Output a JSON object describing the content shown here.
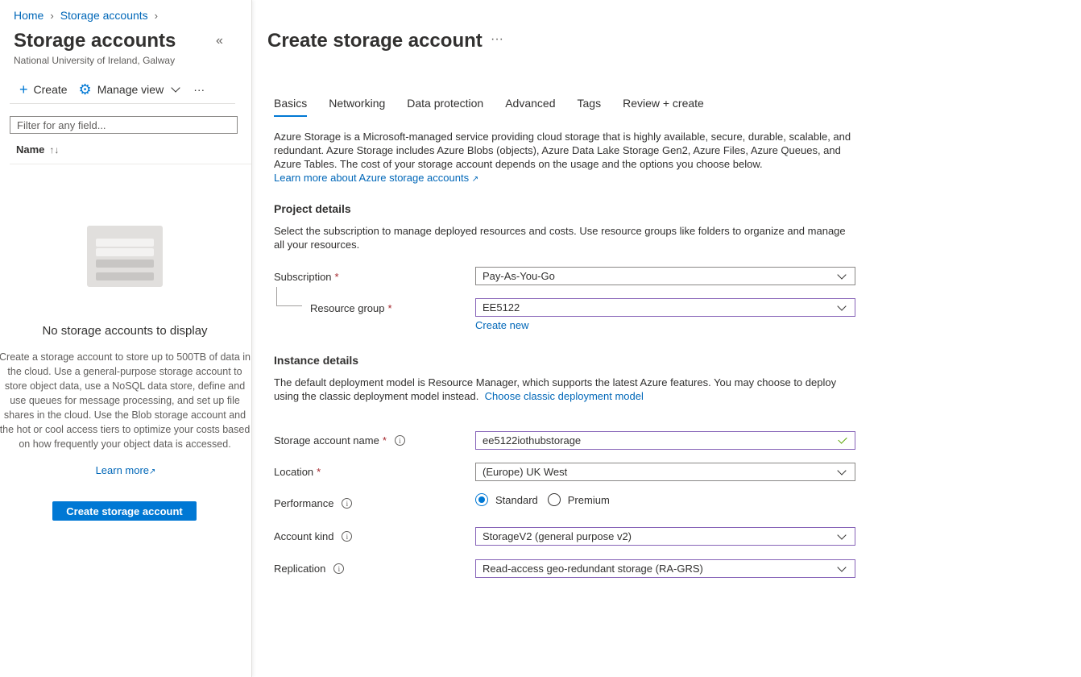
{
  "breadcrumb": {
    "home": "Home",
    "storage_accounts": "Storage accounts"
  },
  "left": {
    "title": "Storage accounts",
    "subtitle": "National University of Ireland, Galway",
    "toolbar": {
      "create": "Create",
      "manage_view": "Manage view",
      "more": "···"
    },
    "filter_placeholder": "Filter for any field...",
    "column_name": "Name",
    "empty_title": "No storage accounts to display",
    "empty_description": "Create a storage account to store up to 500TB of data in the cloud. Use a general-purpose storage account to store object data, use a NoSQL data store, define and use queues for message processing, and set up file shares in the cloud. Use the Blob storage account and the hot or cool access tiers to optimize your costs based on how frequently your object data is accessed.",
    "learn_more": "Learn more",
    "create_button": "Create storage account"
  },
  "main": {
    "title": "Create storage account",
    "more": "···",
    "tabs": [
      {
        "label": "Basics",
        "active": true
      },
      {
        "label": "Networking",
        "active": false
      },
      {
        "label": "Data protection",
        "active": false
      },
      {
        "label": "Advanced",
        "active": false
      },
      {
        "label": "Tags",
        "active": false
      },
      {
        "label": "Review + create",
        "active": false
      }
    ],
    "intro": "Azure Storage is a Microsoft-managed service providing cloud storage that is highly available, secure, durable, scalable, and redundant. Azure Storage includes Azure Blobs (objects), Azure Data Lake Storage Gen2, Azure Files, Azure Queues, and Azure Tables. The cost of your storage account depends on the usage and the options you choose below.",
    "intro_link": "Learn more about Azure storage accounts",
    "project": {
      "heading": "Project details",
      "description": "Select the subscription to manage deployed resources and costs. Use resource groups like folders to organize and manage all your resources.",
      "subscription_label": "Subscription",
      "subscription_value": "Pay-As-You-Go",
      "resource_group_label": "Resource group",
      "resource_group_value": "EE5122",
      "create_new": "Create new"
    },
    "instance": {
      "heading": "Instance details",
      "description": "The default deployment model is Resource Manager, which supports the latest Azure features. You may choose to deploy using the classic deployment model instead.",
      "classic_link": "Choose classic deployment model",
      "name_label": "Storage account name",
      "name_value": "ee5122iothubstorage",
      "location_label": "Location",
      "location_value": "(Europe) UK West",
      "performance_label": "Performance",
      "performance_options": [
        "Standard",
        "Premium"
      ],
      "performance_selected": "Standard",
      "account_kind_label": "Account kind",
      "account_kind_value": "StorageV2 (general purpose v2)",
      "replication_label": "Replication",
      "replication_value": "Read-access geo-redundant storage (RA-GRS)"
    },
    "required_mark": "*"
  },
  "colors": {
    "accent": "#0078d4",
    "link": "#0067b8",
    "required": "#a4262c",
    "focus_border": "#8764b8",
    "valid": "#57a300"
  }
}
